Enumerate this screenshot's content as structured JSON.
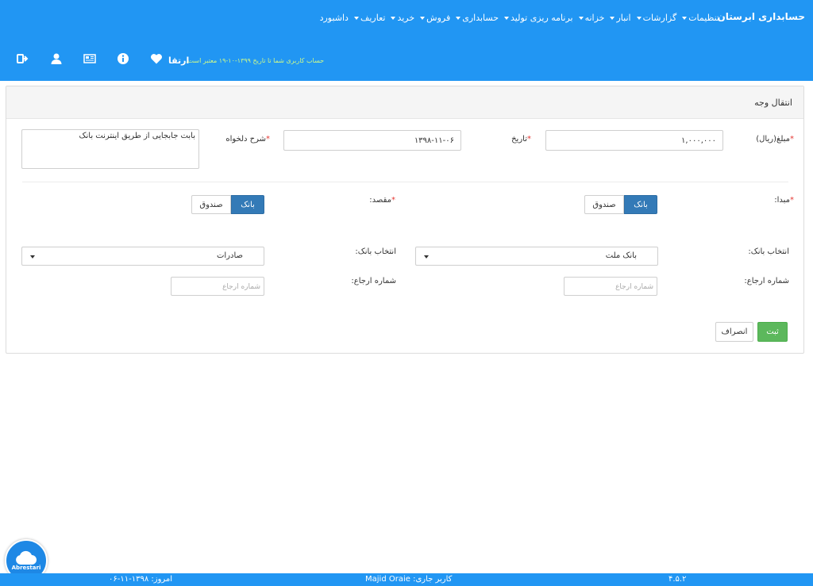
{
  "header": {
    "brand": "حسابداری ابرستان",
    "menu": [
      {
        "label": "داشبورد",
        "caret": false
      },
      {
        "label": "تعاریف",
        "caret": true
      },
      {
        "label": "خرید",
        "caret": true
      },
      {
        "label": "فروش",
        "caret": true
      },
      {
        "label": "حسابداری",
        "caret": true
      },
      {
        "label": "برنامه ریزی تولید",
        "caret": true
      },
      {
        "label": "خزانه",
        "caret": true
      },
      {
        "label": "انبار",
        "caret": true
      },
      {
        "label": "گزارشات",
        "caret": true
      },
      {
        "label": "تنظیمات",
        "caret": true
      }
    ],
    "plan": "ارتقا",
    "license_text": "حساب کاربری شما تا تاریخ ۱۳۹۹-۱۰-۱۹ معتبر است.",
    "icons": [
      "logout-icon",
      "user-icon",
      "newspaper-icon",
      "info-icon",
      "heart-icon"
    ]
  },
  "panel": {
    "title": "انتقال وجه",
    "amount": {
      "label": "مبلغ(ریال)",
      "value": "۱,۰۰۰,۰۰۰"
    },
    "date": {
      "label": "تاریخ",
      "value": "۱۳۹۸-۱۱-۰۶"
    },
    "description": {
      "label": "شرح دلخواه",
      "value": "بابت جابجایی از طریق اینترنت بانک"
    },
    "source": {
      "label": "مبدا:",
      "options": [
        "بانک",
        "صندوق"
      ],
      "selected": "بانک",
      "bank_label": "انتخاب بانک:",
      "bank_value": "بانک ملت",
      "ref_label": "شماره ارجاع:",
      "ref_placeholder": "شماره ارجاع"
    },
    "destination": {
      "label": "مقصد:",
      "options": [
        "بانک",
        "صندوق"
      ],
      "selected": "بانک",
      "bank_label": "انتخاب بانک:",
      "bank_value": "صادرات",
      "ref_label": "شماره ارجاع:",
      "ref_placeholder": "شماره ارجاع"
    },
    "save_label": "ثبت",
    "cancel_label": "انصراف"
  },
  "footer": {
    "version": "۴.۵.۲",
    "current_user": "کاربر جاری: Majid Oraie",
    "today": "امروز: ۱۳۹۸-۱۱-۰۶"
  },
  "logo_text": "Abrestari",
  "colors": {
    "primary": "#2196f3",
    "active": "#337ab7",
    "success": "#5cb85c",
    "required": "#e53935"
  }
}
